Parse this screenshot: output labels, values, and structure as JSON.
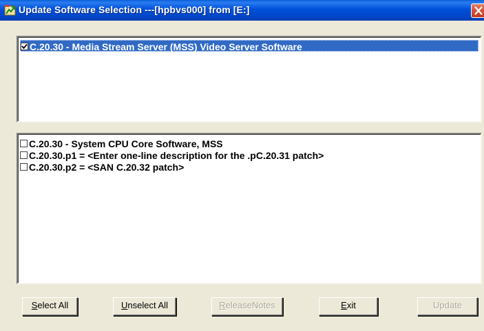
{
  "window": {
    "title": "Update Software Selection ---[hpbvs000] from [E:]"
  },
  "top_list": {
    "items": [
      {
        "label": "C.20.30 - Media Stream Server (MSS) Video Server Software",
        "checked": true,
        "selected": true
      }
    ]
  },
  "bottom_list": {
    "items": [
      {
        "label": "C.20.30 - System CPU Core Software, MSS",
        "checked": false
      },
      {
        "label": "C.20.30.p1 = <Enter one-line description for the .pC.20.31 patch>",
        "checked": false
      },
      {
        "label": "C.20.30.p2 = <SAN C.20.32 patch>",
        "checked": false
      }
    ]
  },
  "buttons": {
    "select_all": {
      "mnemonic": "S",
      "rest": "elect All",
      "enabled": true
    },
    "unselect_all": {
      "mnemonic": "U",
      "rest": "nselect All",
      "enabled": true
    },
    "release_notes": {
      "mnemonic": "R",
      "rest": "eleaseNotes",
      "enabled": false
    },
    "exit": {
      "mnemonic": "E",
      "rest": "xit",
      "enabled": true
    },
    "update": {
      "label": "Update",
      "enabled": false
    }
  },
  "colors": {
    "selection": "#316ac5",
    "titlebar": "#0050d8",
    "window_bg": "#ece9d8",
    "close": "#d8573c"
  },
  "icons": {
    "app": "software-update-icon",
    "close": "close-icon",
    "checkbox_checked": "checkmark-icon"
  }
}
